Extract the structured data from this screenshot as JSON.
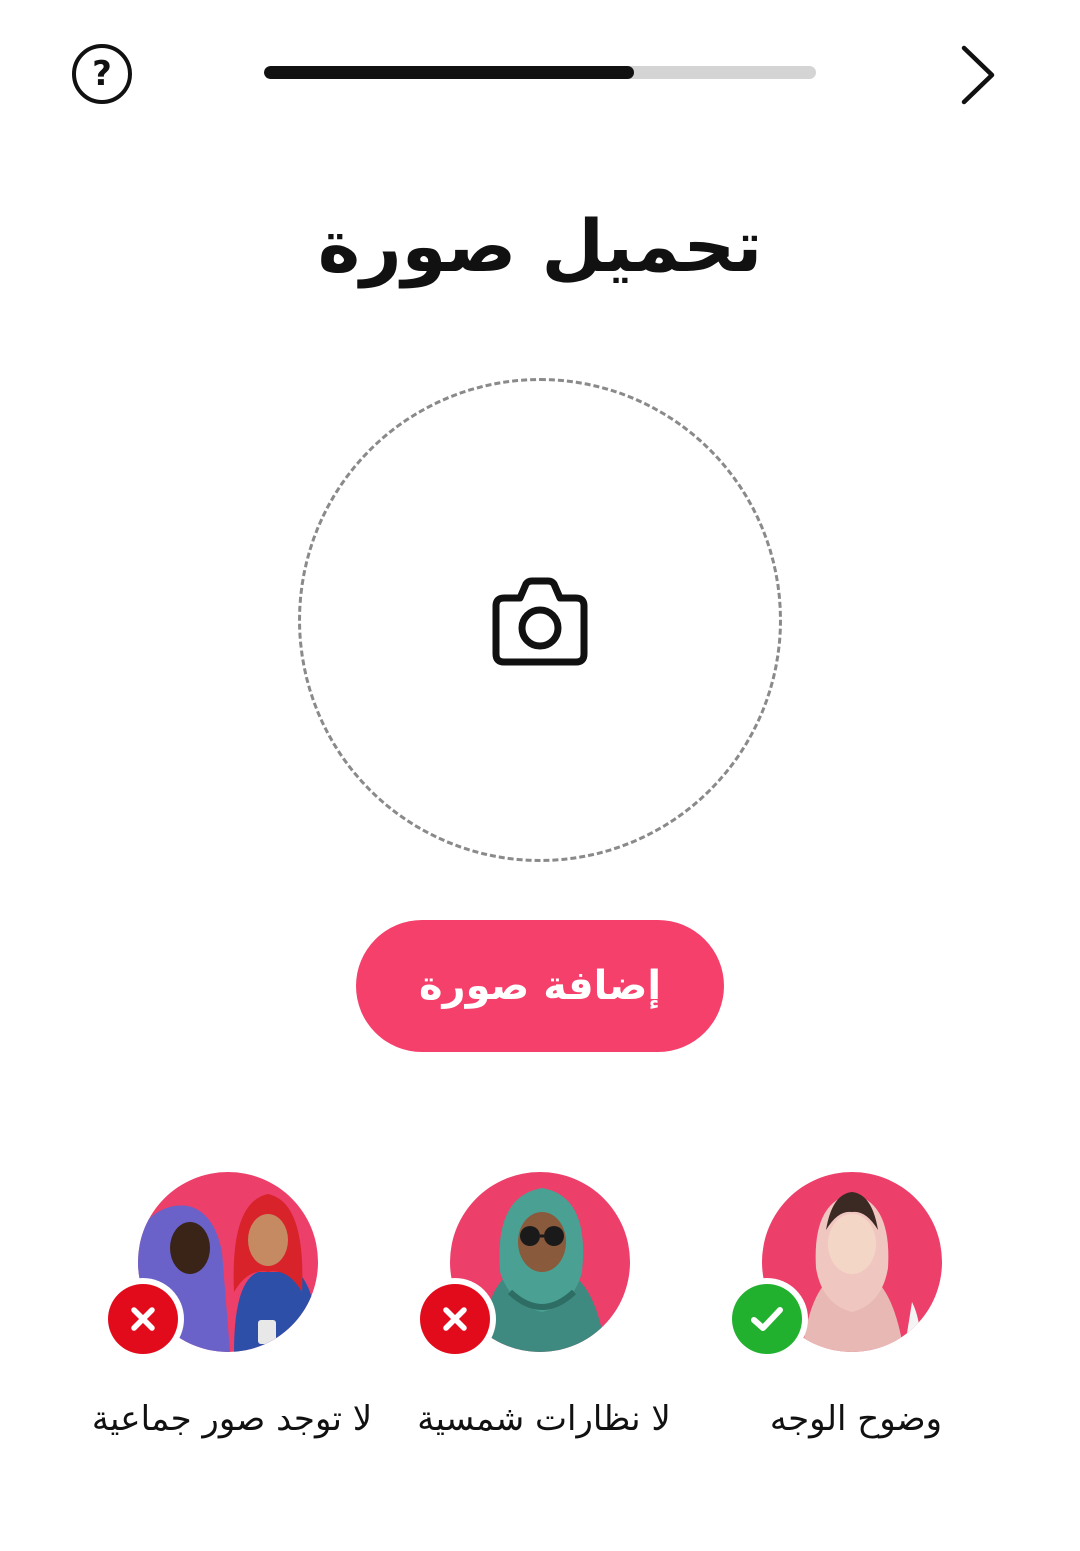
{
  "header": {
    "help_label": "?",
    "progress_value": 0.67,
    "help_icon": "question-circle-icon",
    "next_icon": "chevron-right-icon"
  },
  "title": "تحميل صورة",
  "upload": {
    "icon": "camera-icon"
  },
  "add_button_label": "إضافة صورة",
  "tips": [
    {
      "label": "وضوح الوجه",
      "status": "allowed",
      "status_icon": "check-icon",
      "photo": "woman-face-photo"
    },
    {
      "label": "لا نظارات شمسية",
      "status": "not-allowed",
      "status_icon": "x-icon",
      "photo": "woman-sunglasses-photo"
    },
    {
      "label": "لا توجد صور جماعية",
      "status": "not-allowed",
      "status_icon": "x-icon",
      "photo": "group-photo"
    }
  ],
  "colors": {
    "accent": "#f5406c",
    "avatar_bg": "#ec3f6a",
    "check_green": "#22b02f",
    "cross_red": "#e20b1c",
    "progress_track": "#d4d4d4",
    "progress_fill": "#111111"
  }
}
